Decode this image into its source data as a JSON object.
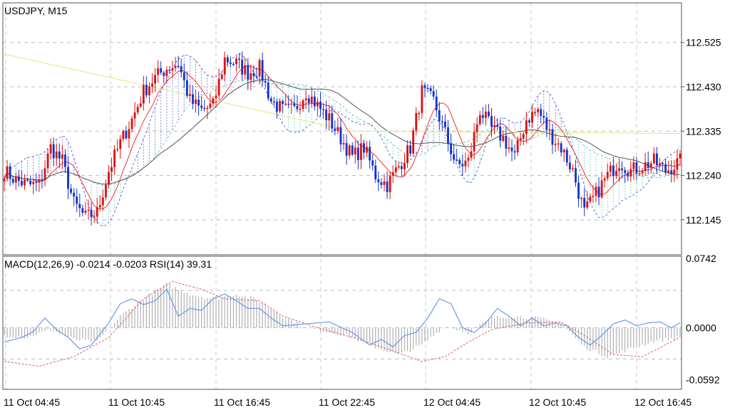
{
  "chart_data": [
    {
      "type": "candlestick",
      "title": "USDJPY, M15",
      "y_ticks": [
        "112.525",
        "112.430",
        "112.335",
        "112.240",
        "112.145"
      ],
      "ylim": [
        112.07,
        112.61
      ],
      "x_ticks": [
        "11 Oct 04:45",
        "11 Oct 10:45",
        "11 Oct 16:45",
        "11 Oct 22:45",
        "12 Oct 04:45",
        "12 Oct 10:45",
        "12 Oct 16:45"
      ],
      "grid": true,
      "colors": {
        "up": "#dd1111",
        "down": "#1133cc",
        "ma_fast": "#ee3333",
        "ma_slow": "#555555",
        "ma_long": "#e6e680",
        "cloud_a": "#6666dd",
        "cloud_b": "#66cccc"
      },
      "anchors_close": [
        [
          0,
          112.25
        ],
        [
          4,
          112.23
        ],
        [
          8,
          112.22
        ],
        [
          12,
          112.22
        ],
        [
          16,
          112.3
        ],
        [
          20,
          112.27
        ],
        [
          24,
          112.18
        ],
        [
          28,
          112.15
        ],
        [
          32,
          112.16
        ],
        [
          36,
          112.25
        ],
        [
          40,
          112.31
        ],
        [
          44,
          112.36
        ],
        [
          48,
          112.42
        ],
        [
          52,
          112.45
        ],
        [
          56,
          112.47
        ],
        [
          60,
          112.48
        ],
        [
          64,
          112.4
        ],
        [
          68,
          112.38
        ],
        [
          72,
          112.39
        ],
        [
          76,
          112.49
        ],
        [
          80,
          112.48
        ],
        [
          84,
          112.46
        ],
        [
          88,
          112.47
        ],
        [
          92,
          112.4
        ],
        [
          96,
          112.38
        ],
        [
          100,
          112.38
        ],
        [
          104,
          112.42
        ],
        [
          108,
          112.39
        ],
        [
          112,
          112.36
        ],
        [
          116,
          112.32
        ],
        [
          120,
          112.28
        ],
        [
          124,
          112.3
        ],
        [
          128,
          112.24
        ],
        [
          132,
          112.22
        ],
        [
          136,
          112.26
        ],
        [
          140,
          112.3
        ],
        [
          144,
          112.42
        ],
        [
          148,
          112.4
        ],
        [
          152,
          112.33
        ],
        [
          156,
          112.26
        ],
        [
          160,
          112.27
        ],
        [
          164,
          112.38
        ],
        [
          168,
          112.34
        ],
        [
          172,
          112.32
        ],
        [
          176,
          112.28
        ],
        [
          180,
          112.36
        ],
        [
          184,
          112.38
        ],
        [
          188,
          112.33
        ],
        [
          192,
          112.3
        ],
        [
          196,
          112.25
        ],
        [
          200,
          112.16
        ],
        [
          204,
          112.2
        ],
        [
          208,
          112.24
        ],
        [
          212,
          112.27
        ],
        [
          216,
          112.25
        ],
        [
          220,
          112.26
        ],
        [
          224,
          112.27
        ],
        [
          228,
          112.25
        ],
        [
          233,
          112.27
        ]
      ]
    },
    {
      "type": "macd",
      "title": "MACD(12,26,9) -0.0214 -0.0203 RSI(14) 39.31",
      "y_ticks": [
        "0.0742",
        "0.0000",
        "-0.0592"
      ],
      "ylim": [
        -0.064,
        0.0742
      ],
      "colors": {
        "histogram": "#b0b0b0",
        "signal": "#e06060",
        "rsi": "#4d88f0"
      },
      "anchors_macd": [
        [
          0,
          -0.008
        ],
        [
          8,
          -0.01
        ],
        [
          16,
          -0.002
        ],
        [
          24,
          -0.012
        ],
        [
          32,
          -0.015
        ],
        [
          40,
          0.012
        ],
        [
          48,
          0.03
        ],
        [
          56,
          0.045
        ],
        [
          64,
          0.035
        ],
        [
          72,
          0.03
        ],
        [
          80,
          0.035
        ],
        [
          88,
          0.028
        ],
        [
          96,
          0.012
        ],
        [
          104,
          0.0
        ],
        [
          112,
          -0.004
        ],
        [
          120,
          -0.01
        ],
        [
          128,
          -0.02
        ],
        [
          136,
          -0.028
        ],
        [
          144,
          -0.018
        ],
        [
          152,
          0.002
        ],
        [
          160,
          -0.005
        ],
        [
          168,
          0.01
        ],
        [
          176,
          0.012
        ],
        [
          184,
          0.01
        ],
        [
          192,
          0.005
        ],
        [
          200,
          -0.02
        ],
        [
          208,
          -0.03
        ],
        [
          216,
          -0.022
        ],
        [
          224,
          -0.014
        ],
        [
          233,
          -0.01
        ]
      ],
      "anchors_signal": [
        [
          0,
          -0.035
        ],
        [
          12,
          -0.04
        ],
        [
          24,
          -0.03
        ],
        [
          36,
          -0.01
        ],
        [
          48,
          0.03
        ],
        [
          58,
          0.048
        ],
        [
          68,
          0.04
        ],
        [
          76,
          0.03
        ],
        [
          88,
          0.028
        ],
        [
          96,
          0.012
        ],
        [
          108,
          0.0
        ],
        [
          120,
          -0.01
        ],
        [
          132,
          -0.022
        ],
        [
          144,
          -0.035
        ],
        [
          152,
          -0.03
        ],
        [
          160,
          -0.015
        ],
        [
          168,
          -0.002
        ],
        [
          180,
          0.005
        ],
        [
          192,
          0.006
        ],
        [
          200,
          -0.008
        ],
        [
          210,
          -0.028
        ],
        [
          220,
          -0.03
        ],
        [
          233,
          -0.01
        ]
      ],
      "anchors_rsi": [
        [
          0,
          -0.015
        ],
        [
          6,
          -0.01
        ],
        [
          10,
          -0.004
        ],
        [
          14,
          0.01
        ],
        [
          18,
          -0.002
        ],
        [
          22,
          -0.01
        ],
        [
          26,
          -0.022
        ],
        [
          30,
          -0.018
        ],
        [
          36,
          0.005
        ],
        [
          40,
          0.025
        ],
        [
          44,
          0.03
        ],
        [
          48,
          0.024
        ],
        [
          52,
          0.028
        ],
        [
          56,
          0.04
        ],
        [
          60,
          0.012
        ],
        [
          64,
          0.02
        ],
        [
          68,
          0.018
        ],
        [
          72,
          0.03
        ],
        [
          76,
          0.035
        ],
        [
          80,
          0.028
        ],
        [
          84,
          0.02
        ],
        [
          88,
          0.02
        ],
        [
          92,
          0.01
        ],
        [
          96,
          0.002
        ],
        [
          104,
          0.004
        ],
        [
          112,
          0.006
        ],
        [
          120,
          -0.005
        ],
        [
          126,
          -0.018
        ],
        [
          130,
          -0.012
        ],
        [
          134,
          -0.02
        ],
        [
          138,
          -0.008
        ],
        [
          142,
          -0.005
        ],
        [
          146,
          0.01
        ],
        [
          150,
          0.03
        ],
        [
          154,
          0.025
        ],
        [
          158,
          0.0
        ],
        [
          162,
          -0.005
        ],
        [
          166,
          0.005
        ],
        [
          170,
          0.02
        ],
        [
          174,
          0.012
        ],
        [
          178,
          0.002
        ],
        [
          182,
          0.01
        ],
        [
          186,
          0.002
        ],
        [
          190,
          0.005
        ],
        [
          194,
          0.002
        ],
        [
          198,
          -0.01
        ],
        [
          202,
          -0.018
        ],
        [
          206,
          -0.008
        ],
        [
          210,
          0.004
        ],
        [
          214,
          0.008
        ],
        [
          218,
          0.002
        ],
        [
          222,
          0.005
        ],
        [
          226,
          0.006
        ],
        [
          230,
          0.0
        ],
        [
          233,
          0.005
        ]
      ]
    }
  ]
}
